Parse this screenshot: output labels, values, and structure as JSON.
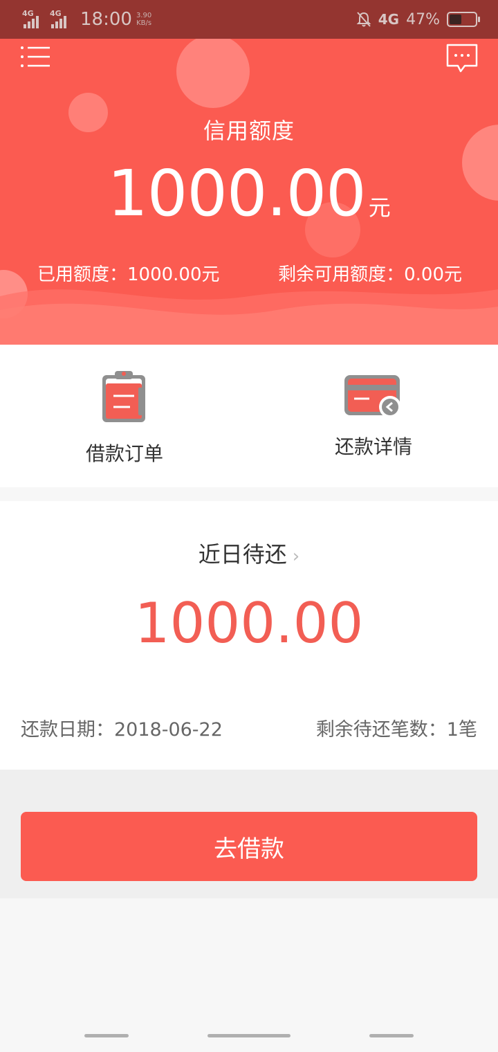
{
  "status_bar": {
    "sim1_tag": "4G",
    "sim2_tag": "4G",
    "time": "18:00",
    "speed_value": "3.90",
    "speed_unit": "KB/s",
    "network": "4G",
    "battery_percent": "47%",
    "battery_level": 0.47
  },
  "header": {
    "menu_icon": "menu-icon",
    "message_icon": "message-icon",
    "credit_title": "信用额度",
    "credit_amount": "1000.00",
    "credit_unit": "元",
    "used_label": "已用额度：1000.00元",
    "remaining_label": "剩余可用额度：0.00元"
  },
  "actions": [
    {
      "label": "借款订单",
      "icon": "clipboard-icon"
    },
    {
      "label": "还款详情",
      "icon": "card-repay-icon"
    }
  ],
  "repay": {
    "title": "近日待还",
    "chevron": "›",
    "amount": "1000.00",
    "date_label": "还款日期：2018-06-22",
    "count_label": "剩余待还笔数：1笔"
  },
  "borrow_button": "去借款",
  "colors": {
    "brand": "#fb5b51",
    "amount_red": "#f25e54",
    "status_bar": "#943530"
  }
}
